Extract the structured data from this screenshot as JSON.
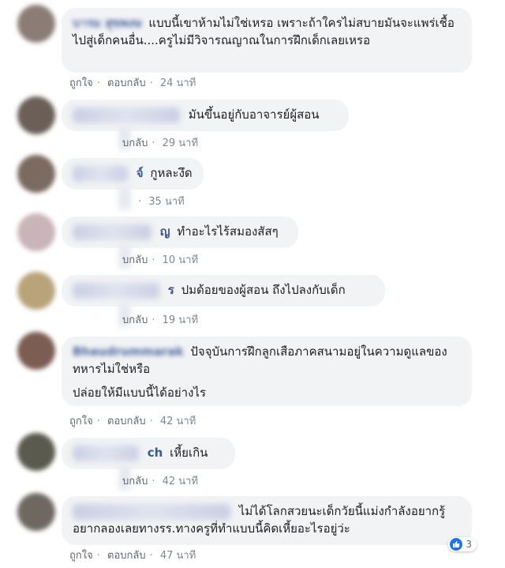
{
  "comments": [
    {
      "name": "บารม สุขพงษ",
      "text": "แบบนี้เขาห้ามไม่ใช่เหรอ เพราะถ้าใครไม่สบายมันจะแพร่เชื้อไปสู่เด็กคนอื่น....ครูไม่มีวิจารณญาณในการฝึกเด็กเลยเหรอ",
      "like": "ถูกใจ",
      "reply": "ตอบกลับ",
      "time": "24 นาที",
      "avatar": "#8b7d76"
    },
    {
      "name": "",
      "text": "มันขึ้นอยู่กับอาจารย์ผู้สอน",
      "like": "",
      "reply": "บกลับ",
      "time": "29 นาที",
      "avatar": "#6b5f58"
    },
    {
      "name": "จ์",
      "text": "กูหละงึด",
      "like": "",
      "reply": "",
      "time": "35 นาที",
      "avatar": "#7a6a60"
    },
    {
      "name": "ญ",
      "text": "ทำอะไรไร้สมองสัสๆ",
      "like": "",
      "reply": "บกลับ",
      "time": "10 นาที",
      "avatar": "#c9b4b9"
    },
    {
      "name": "ร",
      "text": "ปมด้อยของผู้สอน ถึงไปลงกับเด็ก",
      "like": "",
      "reply": "บกลับ",
      "time": "19 นาที",
      "avatar": "#b9a47a"
    },
    {
      "name": "Bhaudrummarak",
      "text": "ปัจจุบันการฝึกลูกเสือภาคสนามอยู่ในความดูแลของทหารไม่ใช่หรือ",
      "text2": "ปล่อยให้มีแบบนี้ได้อย่างไร",
      "like": "ถูกใจ",
      "reply": "ตอบกลับ",
      "time": "42 นาที",
      "avatar": "#7b5d52"
    },
    {
      "name": "ch",
      "text": "เหี้ยเกิน",
      "like": "",
      "reply": "บกลับ",
      "time": "42 นาที",
      "avatar": "#5a5a4e"
    },
    {
      "name": "",
      "text": "ไม่ได้โลกสวยนะเด็กวัยนี้แม่งกำลังอยากรู้อยากลองเลยทางรร.ทางครูที่ทำแบบนี้คิดเหี้ยอะไรอยู่ว่ะ",
      "like": "ถูกใจ",
      "reply": "ตอบกลับ",
      "time": "47 นาที",
      "avatar": "#6e6861"
    }
  ],
  "reaction_count": "3",
  "colors": {
    "link": "#385898",
    "bubble": "#f2f3f5",
    "meta": "#616770",
    "like_blue": "#1877f2"
  }
}
